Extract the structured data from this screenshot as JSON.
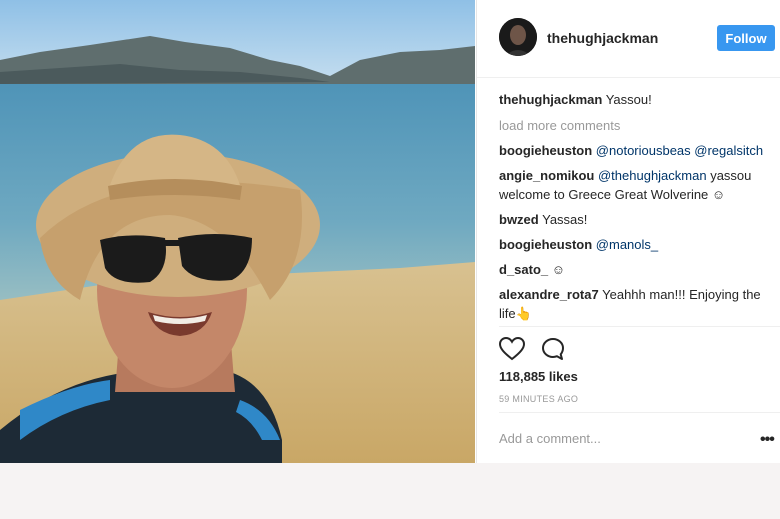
{
  "post": {
    "username": "thehughjackman",
    "follow_label": "Follow",
    "caption_user": "thehughjackman",
    "caption_text": "Yassou!",
    "load_more": "load more comments",
    "comments": [
      {
        "user": "boogieheuston",
        "mention": "@notoriousbeas @regalsitch",
        "text": ""
      },
      {
        "user": "angie_nomikou",
        "mention": "@thehughjackman",
        "text": " yassou welcome to Greece Great Wolverine ☺"
      },
      {
        "user": "bwzed",
        "mention": "",
        "text": "Yassas!"
      },
      {
        "user": "boogieheuston",
        "mention": "@manols_",
        "text": ""
      },
      {
        "user": "d_sato_",
        "mention": "",
        "text": "☺"
      },
      {
        "user": "alexandre_rota7",
        "mention": "",
        "text": "Yeahhh man!!! Enjoying the life👆"
      }
    ],
    "likes": "118,885 likes",
    "time": "59 MINUTES AGO",
    "add_comment_placeholder": "Add a comment...",
    "more_label": "•••"
  },
  "icons": {
    "like": "heart-icon",
    "comment": "comment-bubble-icon",
    "more": "more-options-icon"
  },
  "colors": {
    "follow_button": "#3897f0",
    "username": "#262626",
    "mention": "#003569",
    "muted": "#999999"
  }
}
